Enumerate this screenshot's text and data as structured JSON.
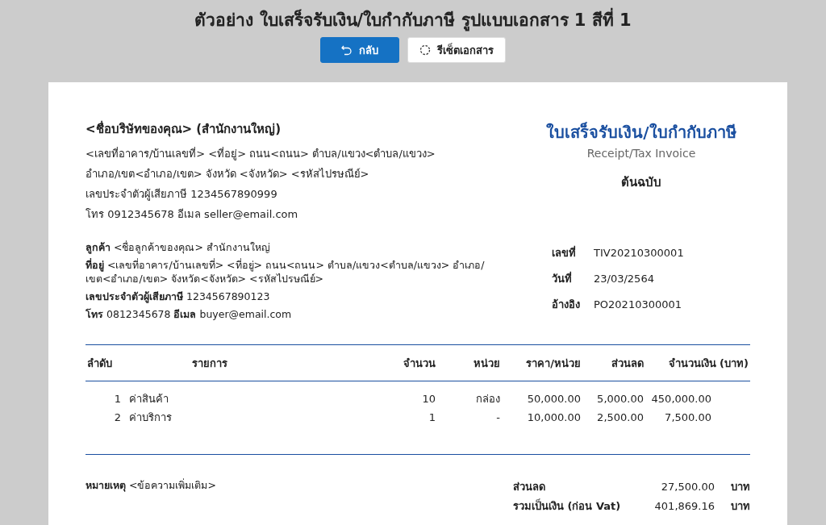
{
  "page_title": "ตัวอย่าง ใบเสร็จรับเงิน/ใบกำกับภาษี รูปแบบเอกสาร 1 สีที่ 1",
  "buttons": [
    {
      "kind": "back",
      "label": "กลับ"
    },
    {
      "kind": "reset",
      "label": "รีเซ็ตเอกสาร"
    }
  ],
  "seller": {
    "name": "<ชื่อบริษัทของคุณ> (สำนักงานใหญ่)",
    "lines": [
      "<เลขที่อาคาร/บ้านเลขที่> <ที่อยู่> ถนน<ถนน> ตำบล/แขวง<ตำบล/แขวง>",
      "อำเภอ/เขต<อำเภอ/เขต> จังหวัด <จังหวัด> <รหัสไปรษณีย์>",
      "เลขประจำตัวผู้เสียภาษี 1234567890999",
      "โทร 0912345678  อีเมล seller@email.com"
    ]
  },
  "doc_title": "ใบเสร็จรับเงิน/ใบกำกับภาษี",
  "doc_subtitle": "Receipt/Tax Invoice",
  "copy_label": "ต้นฉบับ",
  "buyer_lines": [
    "**ลูกค้า** <ชื่อลูกค้าของคุณ> สำนักงานใหญ่",
    "**ที่อยู่** <เลขที่อาคาร/บ้านเลขที่> <ที่อยู่> ถนน<ถนน> ตำบล/แขวง<ตำบล/แขวง> อำเภอ/เขต<อำเภอ/เขต> จังหวัด<จังหวัด> <รหัสไปรษณีย์>",
    "**เลขประจำตัวผู้เสียภาษี** 1234567890123",
    "**โทร** 0812345678  **อีเมล** buyer@email.com"
  ],
  "meta": [
    {
      "label": "เลขที่",
      "value": "TIV20210300001"
    },
    {
      "label": "วันที่",
      "value": "23/03/2564"
    },
    {
      "label": "อ้างอิง",
      "value": "PO20210300001"
    }
  ],
  "table": {
    "columns": [
      "ลำดับ",
      "รายการ",
      "จำนวน",
      "หน่วย",
      "ราคา/หน่วย",
      "ส่วนลด",
      "จำนวนเงิน (บาท)"
    ],
    "rows": [
      [
        "1",
        "ค่าสินค้า",
        "10",
        "กล่อง",
        "50,000.00",
        "5,000.00",
        "450,000.00"
      ],
      [
        "2",
        "ค่าบริการ",
        "1",
        "-",
        "10,000.00",
        "2,500.00",
        "7,500.00"
      ]
    ]
  },
  "note": "**หมายเหตุ** <ข้อความเพิ่มเติม>",
  "totals": [
    {
      "label": "ส่วนลด",
      "value": "27,500.00",
      "unit": "บาท"
    },
    {
      "label": "รวมเป็นเงิน (ก่อน Vat)",
      "value": "401,869.16",
      "unit": "บาท"
    }
  ]
}
